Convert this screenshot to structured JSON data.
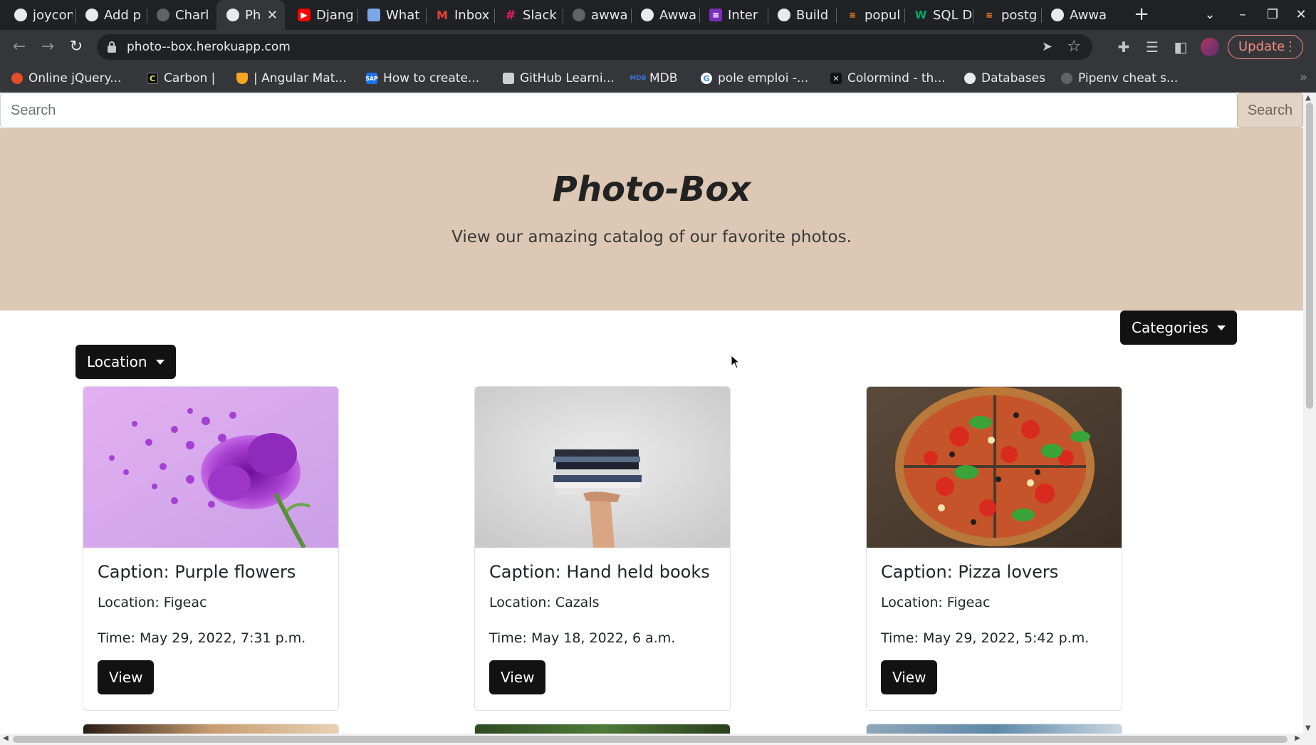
{
  "browser": {
    "tabs": [
      {
        "title": "joycon",
        "icon": "github-icon",
        "color": "#e8eaed"
      },
      {
        "title": "Add p",
        "icon": "globe-icon",
        "color": "#e8eaed"
      },
      {
        "title": "Charl",
        "icon": "github-icon",
        "color": "#e8eaed"
      },
      {
        "title": "Ph",
        "icon": "globe-icon",
        "color": "#e8eaed",
        "active": true
      },
      {
        "title": "Djang",
        "icon": "youtube-icon",
        "color": "#ff0000"
      },
      {
        "title": "What",
        "icon": "image-icon",
        "color": "#7aa7e8"
      },
      {
        "title": "Inbox",
        "icon": "gmail-icon",
        "color": "#ea4335"
      },
      {
        "title": "Slack",
        "icon": "slack-icon",
        "color": "#e01e5a"
      },
      {
        "title": "awwa",
        "icon": "github-icon",
        "color": "#e8eaed"
      },
      {
        "title": "Awwa",
        "icon": "globe-icon",
        "color": "#e8eaed"
      },
      {
        "title": "Inter",
        "icon": "list-icon",
        "color": "#7b2fbe"
      },
      {
        "title": "Build",
        "icon": "puzzle-icon",
        "color": "#e8eaed"
      },
      {
        "title": "popul",
        "icon": "stackoverflow-icon",
        "color": "#f48024"
      },
      {
        "title": "SQL D",
        "icon": "w3-icon",
        "color": "#04aa6d"
      },
      {
        "title": "postg",
        "icon": "stackoverflow-icon",
        "color": "#f48024"
      },
      {
        "title": "Awwa",
        "icon": "globe-icon",
        "color": "#e8eaed"
      }
    ],
    "url": "photo--box.herokuapp.com",
    "update_label": "Update",
    "bookmarks": [
      {
        "label": "Online jQuery...",
        "icon": "jquery-icon",
        "color": "#e44d26"
      },
      {
        "label": "Carbon |",
        "icon": "carbon-icon",
        "color": "#111111"
      },
      {
        "label": "| Angular Mat...",
        "icon": "angular-icon",
        "color": "#f5a623"
      },
      {
        "label": "How to create...",
        "icon": "sap-icon",
        "color": "#1a73e8"
      },
      {
        "label": "GitHub Learni...",
        "icon": "github-learning-icon",
        "color": "#cfcfcf"
      },
      {
        "label": "MDB",
        "icon": "mdb-icon",
        "color": "#3b71ca"
      },
      {
        "label": "pole emploi -...",
        "icon": "google-icon",
        "color": "#ffffff"
      },
      {
        "label": "Colormind - th...",
        "icon": "colormind-icon",
        "color": "#111111"
      },
      {
        "label": "Databases",
        "icon": "globe-icon",
        "color": "#e8eaed"
      },
      {
        "label": "Pipenv cheat s...",
        "icon": "github-icon",
        "color": "#e8eaed"
      }
    ]
  },
  "search": {
    "placeholder": "Search",
    "button_label": "Search"
  },
  "hero": {
    "title": "Photo-Box",
    "subtitle": "View our amazing catalog of our favorite photos."
  },
  "filters": {
    "categories_label": "Categories",
    "location_label": "Location"
  },
  "cards": [
    {
      "caption": "Caption: Purple flowers",
      "location": "Location: Figeac",
      "time": "Time: May 29, 2022, 7:31 p.m.",
      "view_label": "View",
      "image": "purple-flowers-photo"
    },
    {
      "caption": "Caption: Hand held books",
      "location": "Location: Cazals",
      "time": "Time: May 18, 2022, 6 a.m.",
      "view_label": "View",
      "image": "hand-held-books-photo"
    },
    {
      "caption": "Caption: Pizza lovers",
      "location": "Location: Figeac",
      "time": "Time: May 29, 2022, 5:42 p.m.",
      "view_label": "View",
      "image": "pizza-photo"
    }
  ],
  "colors": {
    "hero_bg": "#dcc8b5",
    "button_dark": "#121212",
    "search_button_bg": "#e2d4c4"
  }
}
